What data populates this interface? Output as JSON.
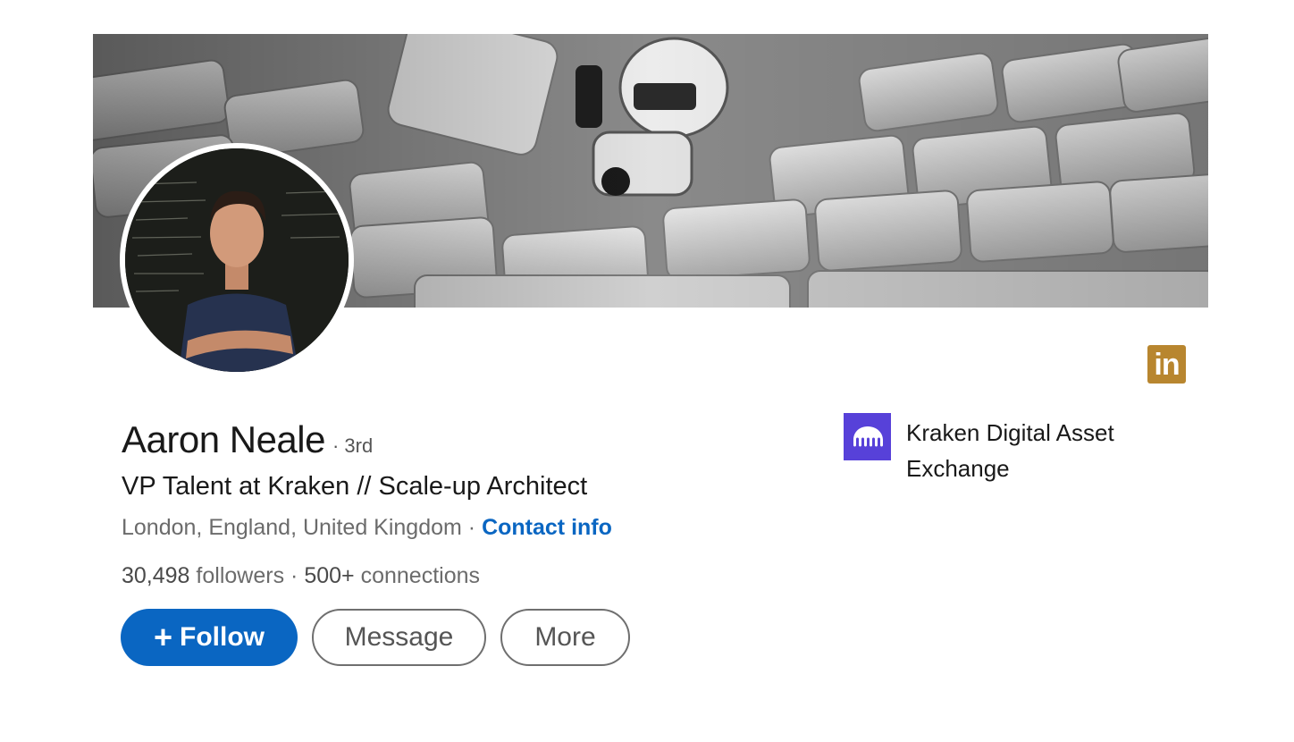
{
  "profile": {
    "name": "Aaron Neale",
    "degree": "· 3rd",
    "headline": "VP Talent at Kraken // Scale-up Architect",
    "location": "London, England, United Kingdom",
    "location_separator": " · ",
    "contact_info_label": "Contact info",
    "followers_count": "30,498",
    "followers_label": "followers",
    "stats_separator": " · ",
    "connections_count": "500+",
    "connections_label": "connections"
  },
  "actions": {
    "follow_icon": "+",
    "follow_label": "Follow",
    "message_label": "Message",
    "more_label": "More"
  },
  "company": {
    "name": "Kraken Digital Asset Exchange",
    "logo_icon": "kraken-logo-icon",
    "logo_color": "#5741d9"
  },
  "badge": {
    "icon": "linkedin-icon",
    "text": "in",
    "color": "#b8862f"
  },
  "colors": {
    "accent": "#0a66c2",
    "text_primary": "#191919",
    "text_secondary": "#6b6b6b"
  }
}
